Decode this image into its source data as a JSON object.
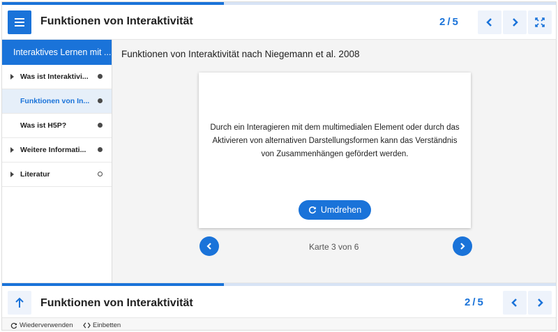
{
  "header": {
    "title": "Funktionen von Interaktivität",
    "page_current": "2",
    "page_separator": "/",
    "page_total": "5",
    "progress_fraction": 0.4
  },
  "sidebar": {
    "heading": "Interaktives Lernen mit ...",
    "items": [
      {
        "label": "Was ist Interaktivi...",
        "expandable": true,
        "status": "filled"
      },
      {
        "label": "Funktionen von In...",
        "expandable": false,
        "status": "filled",
        "active": true
      },
      {
        "label": "Was ist H5P?",
        "expandable": false,
        "status": "filled"
      },
      {
        "label": "Weitere Informati...",
        "expandable": true,
        "status": "filled"
      },
      {
        "label": "Literatur",
        "expandable": true,
        "status": "empty"
      }
    ]
  },
  "main": {
    "title": "Funktionen von Interaktivität nach Niegemann et al. 2008",
    "card_text": "Durch ein Interagieren mit dem multimedialen Element oder durch das Aktivieren von alternativen Darstellungsformen kann das Verständnis von Zusammenhängen gefördert werden.",
    "flip_label": "Umdrehen",
    "card_counter": "Karte 3 von 6"
  },
  "footer": {
    "title": "Funktionen von Interaktivität",
    "page_current": "2",
    "page_separator": "/",
    "page_total": "5"
  },
  "bottom_bar": {
    "reuse_label": "Wiederverwenden",
    "embed_label": "Einbetten"
  },
  "colors": {
    "accent": "#1a73d9",
    "accent_light": "#eef3fb",
    "progress_track": "#d7e3f5",
    "active_item_bg": "#e6eff9"
  },
  "icons": {
    "menu": "hamburger-icon",
    "prev": "chevron-left-icon",
    "next": "chevron-right-icon",
    "fullscreen": "fullscreen-icon",
    "flip": "refresh-icon",
    "up": "arrow-up-icon",
    "reuse": "refresh-icon",
    "embed": "code-icon"
  }
}
